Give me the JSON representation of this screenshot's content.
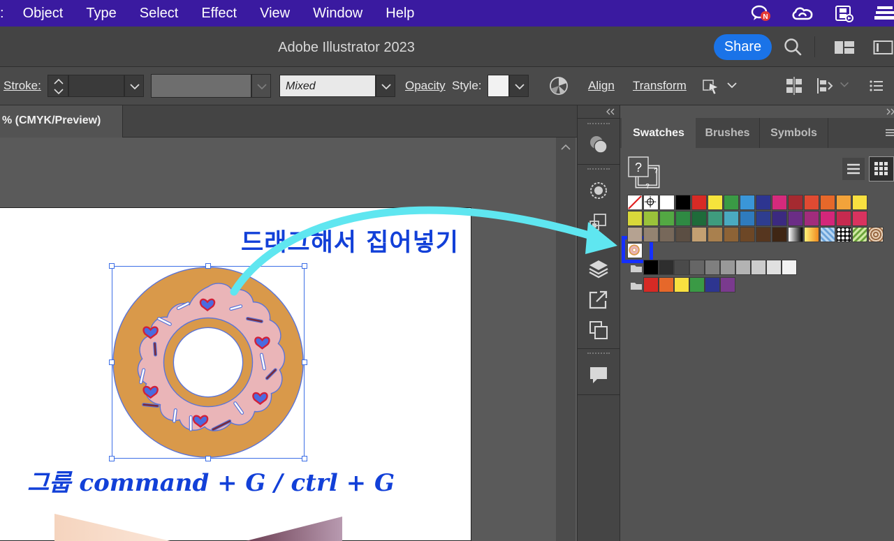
{
  "menu": {
    "items": [
      "Object",
      "Type",
      "Select",
      "Effect",
      "View",
      "Window",
      "Help"
    ],
    "clipped_first": ":"
  },
  "app": {
    "title": "Adobe Illustrator 2023",
    "share_label": "Share"
  },
  "control_bar": {
    "stroke_label": "Stroke:",
    "brush_value": "Mixed",
    "opacity_label": "Opacity",
    "style_label": "Style:",
    "align_label": "Align",
    "transform_label": "Transform"
  },
  "document": {
    "tab_label": "% (CMYK/Preview)"
  },
  "canvas": {
    "caption_drag": "드래그해서 집어넣기",
    "caption_group": "그룹 command + G / ctrl + G"
  },
  "swatches_panel": {
    "tabs": [
      "Swatches",
      "Brushes",
      "Symbols"
    ],
    "active_tab": "Swatches",
    "rows": [
      [
        "none",
        "registration",
        "#ffffff",
        "#000000",
        "#d72a25",
        "#f6e43c",
        "#3a9a45",
        "#3a96d8",
        "#2d3590",
        "#d52a7c",
        "#a52a30",
        "#e04a32",
        "#e6682a",
        "#f2a33a",
        "#f8e040"
      ],
      [
        "#d8d83a",
        "#9ac23a",
        "#53a843",
        "#2f8a43",
        "#1f6b3a",
        "#3f9c7e",
        "#4aaac0",
        "#2f7bbd",
        "#2e3d8f",
        "#3b2a80",
        "#6b2d86",
        "#a12c7c",
        "#d4267a",
        "#c72a4f",
        "#d8335f"
      ],
      [
        "#b5a291",
        "#948371",
        "#77685a",
        "#5b4e43",
        "#c3a072",
        "#a9804e",
        "#8d6336",
        "#6d4726",
        "#56361f",
        "#3f2614",
        "gradient-bw",
        "gradient-orange",
        "pattern-blue",
        "pattern-dots",
        "pattern-leaf",
        "pattern-brown"
      ],
      [
        "donut-symbol"
      ]
    ],
    "grays": [
      "#000000",
      "#2e2e2e",
      "#4a4a4a",
      "#666666",
      "#7f7f7f",
      "#999999",
      "#b3b3b3",
      "#cccccc",
      "#e0e0e0",
      "#f2f2f2"
    ],
    "brights": [
      "#d72a25",
      "#e6682a",
      "#f8e040",
      "#3a9a45",
      "#2d3590",
      "#7a3a8e"
    ]
  },
  "colors": {
    "menubar": "#3a1aa0",
    "accent_blue": "#1a73e8",
    "caption_blue": "#1240d8",
    "arrow_cyan": "#5fe6f0",
    "highlight_box": "#1530ff"
  }
}
